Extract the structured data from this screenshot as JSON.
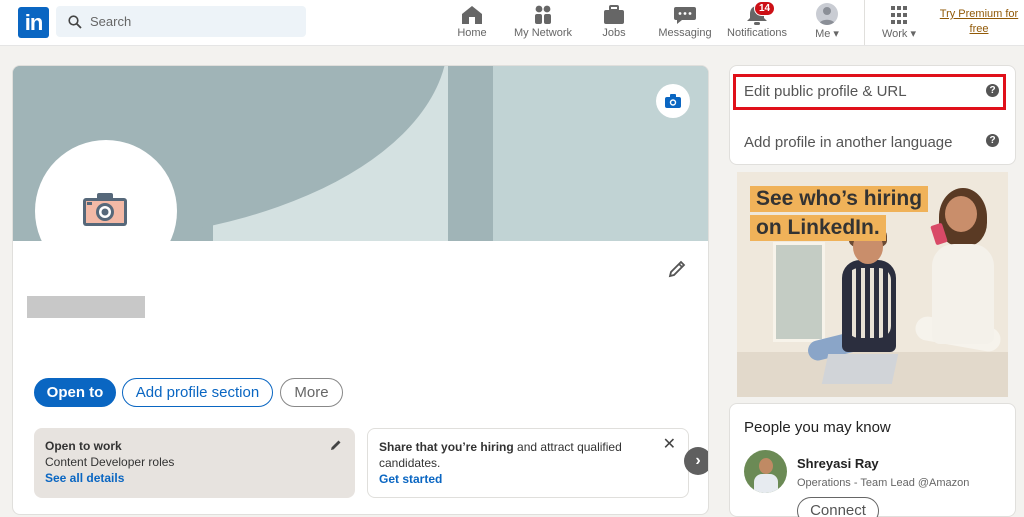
{
  "nav": {
    "logo": "in",
    "search_placeholder": "Search",
    "items": [
      {
        "label": "Home",
        "icon": "home-icon"
      },
      {
        "label": "My Network",
        "icon": "network-icon"
      },
      {
        "label": "Jobs",
        "icon": "jobs-icon"
      },
      {
        "label": "Messaging",
        "icon": "messaging-icon"
      },
      {
        "label": "Notifications",
        "icon": "bell-icon",
        "badge": "14"
      },
      {
        "label": "Me ▾",
        "icon": "avatar"
      },
      {
        "label": "Work ▾",
        "icon": "grid-icon"
      }
    ],
    "premium": "Try Premium for free"
  },
  "profile": {
    "open_to": "Open to",
    "add_section": "Add profile section",
    "more": "More",
    "open_to_work": {
      "title": "Open to work",
      "roles": "Content Developer roles",
      "link": "See all details"
    },
    "hiring": {
      "text_strong": "Share that you’re hiring",
      "text_rest": " and attract qualified candidates.",
      "link": "Get started"
    }
  },
  "sidebar": {
    "edit_public": "Edit public profile & URL",
    "add_language": "Add profile in another language",
    "ad_line1": "See who’s hiring",
    "ad_line2": "on LinkedIn."
  },
  "people": {
    "heading": "People you may know",
    "name": "Shreyasi Ray",
    "role": "Operations - Team Lead @Amazon",
    "connect": "Connect"
  },
  "colors": {
    "brand": "#0a66c2",
    "highlight": "#e0101a",
    "badge": "#cc1016",
    "premium": "#915907",
    "ad_tag": "#f0b259"
  }
}
